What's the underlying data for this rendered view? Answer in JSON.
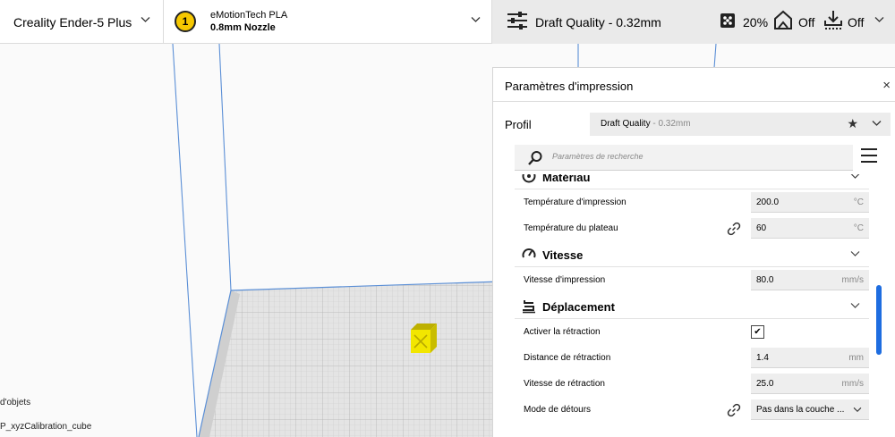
{
  "topbar": {
    "printer_name": "Creality Ender-5 Plus",
    "extruder": {
      "number": "1",
      "material": "eMotionTech PLA",
      "nozzle": "0.8mm Nozzle"
    },
    "print_setup": {
      "quality": "Draft Quality - 0.32mm",
      "infill": "20%",
      "support": "Off",
      "adhesion": "Off"
    }
  },
  "viewport": {
    "object_list_label": "d'objets",
    "object_name": "P_xyzCalibration_cube"
  },
  "panel": {
    "title": "Paramètres d'impression",
    "close_icon": "×",
    "profile_label": "Profil",
    "profile_name": "Draft Quality",
    "profile_layer": " - 0.32mm",
    "search_placeholder": "Paramètres de recherche",
    "categories": {
      "material": {
        "label": "Matériau",
        "icon": "material-spool-icon"
      },
      "speed": {
        "label": "Vitesse",
        "icon": "speedometer-icon"
      },
      "travel": {
        "label": "Déplacement",
        "icon": "travel-path-icon"
      }
    },
    "settings": {
      "print_temp": {
        "label": "Température d'impression",
        "value": "200.0",
        "unit": "°C"
      },
      "bed_temp": {
        "label": "Température du plateau",
        "value": "60",
        "unit": "°C"
      },
      "print_speed": {
        "label": "Vitesse d'impression",
        "value": "80.0",
        "unit": "mm/s"
      },
      "retraction_enable": {
        "label": "Activer la rétraction",
        "checked": true,
        "check_mark": "✔"
      },
      "retraction_distance": {
        "label": "Distance de rétraction",
        "value": "1.4",
        "unit": "mm"
      },
      "retraction_speed": {
        "label": "Vitesse de rétraction",
        "value": "25.0",
        "unit": "mm/s"
      },
      "combing_mode": {
        "label": "Mode de détours",
        "value": "Pas dans la couche ..."
      }
    }
  },
  "colors": {
    "accent": "#1e6de0",
    "extruder_badge": "#f6c800",
    "cube": "#f2e600",
    "build_plate": "#e4e4e4"
  }
}
